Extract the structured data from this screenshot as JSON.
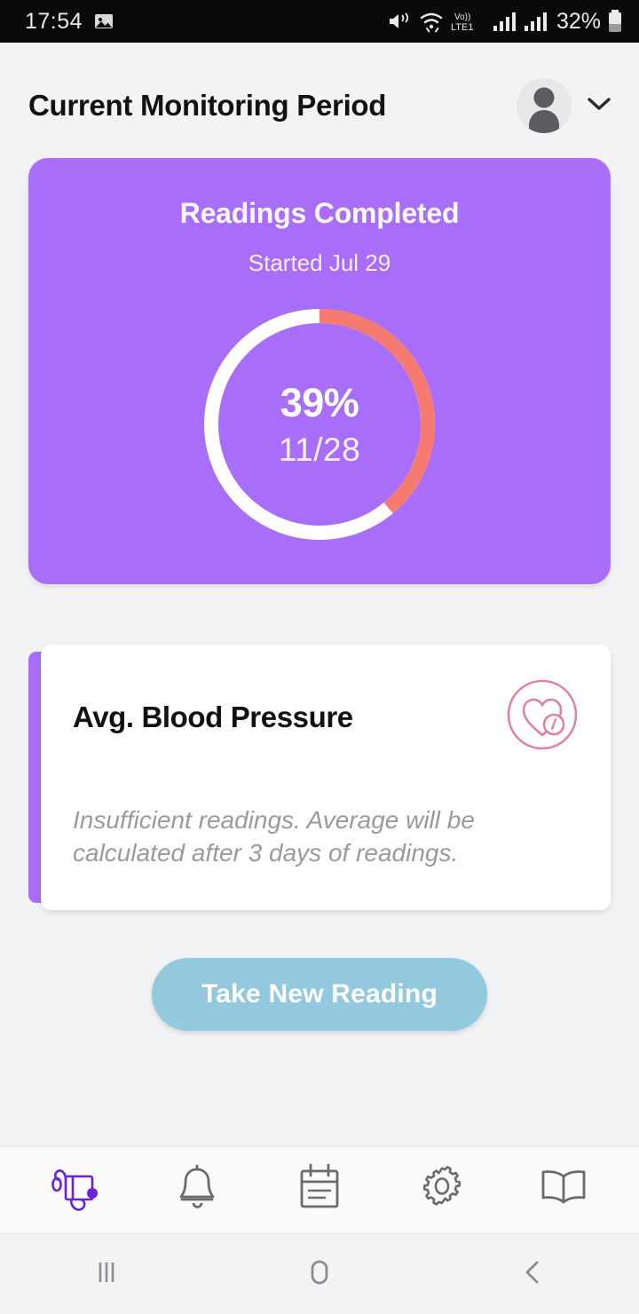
{
  "statusbar": {
    "time": "17:54",
    "battery_text": "32%",
    "network_label": "LTE1",
    "volte_label": "Vo))",
    "icons": [
      "image-icon",
      "mute-vibrate-icon",
      "wifi-icon",
      "volte-icon",
      "signal-bars-icon",
      "signal-bars-2-icon",
      "battery-icon"
    ]
  },
  "header": {
    "title": "Current Monitoring Period",
    "avatar_icon": "person-avatar-icon",
    "chevron_icon": "chevron-down-icon"
  },
  "progress_card": {
    "title": "Readings Completed",
    "subtitle": "Started Jul 29",
    "percent_label": "39%",
    "fraction_label": "11/28",
    "percent_value": 39,
    "completed": 11,
    "total": 28,
    "track_color": "#ffffff",
    "progress_color": "#f57b70",
    "card_color": "#a86efa"
  },
  "bp_card": {
    "title": "Avg. Blood Pressure",
    "icon": "heart-gauge-icon",
    "note": "Insufficient readings. Average will be calculated after 3 days of readings.",
    "accent_color": "#a86efa",
    "icon_color": "#dd8498"
  },
  "cta": {
    "label": "Take New Reading",
    "color": "#92c9de"
  },
  "tabbar": {
    "active_color": "#6b21d6",
    "inactive_color": "#6b6b6b",
    "items": [
      {
        "name": "tab-monitor",
        "icon": "blood-pressure-monitor-icon",
        "active": true
      },
      {
        "name": "tab-alerts",
        "icon": "bell-icon",
        "active": false
      },
      {
        "name": "tab-log",
        "icon": "notepad-calendar-icon",
        "active": false
      },
      {
        "name": "tab-settings",
        "icon": "gear-icon",
        "active": false
      },
      {
        "name": "tab-guide",
        "icon": "open-book-icon",
        "active": false
      }
    ]
  },
  "androidnav": {
    "recents_icon": "recents-icon",
    "home_icon": "home-icon",
    "back_icon": "back-icon"
  }
}
